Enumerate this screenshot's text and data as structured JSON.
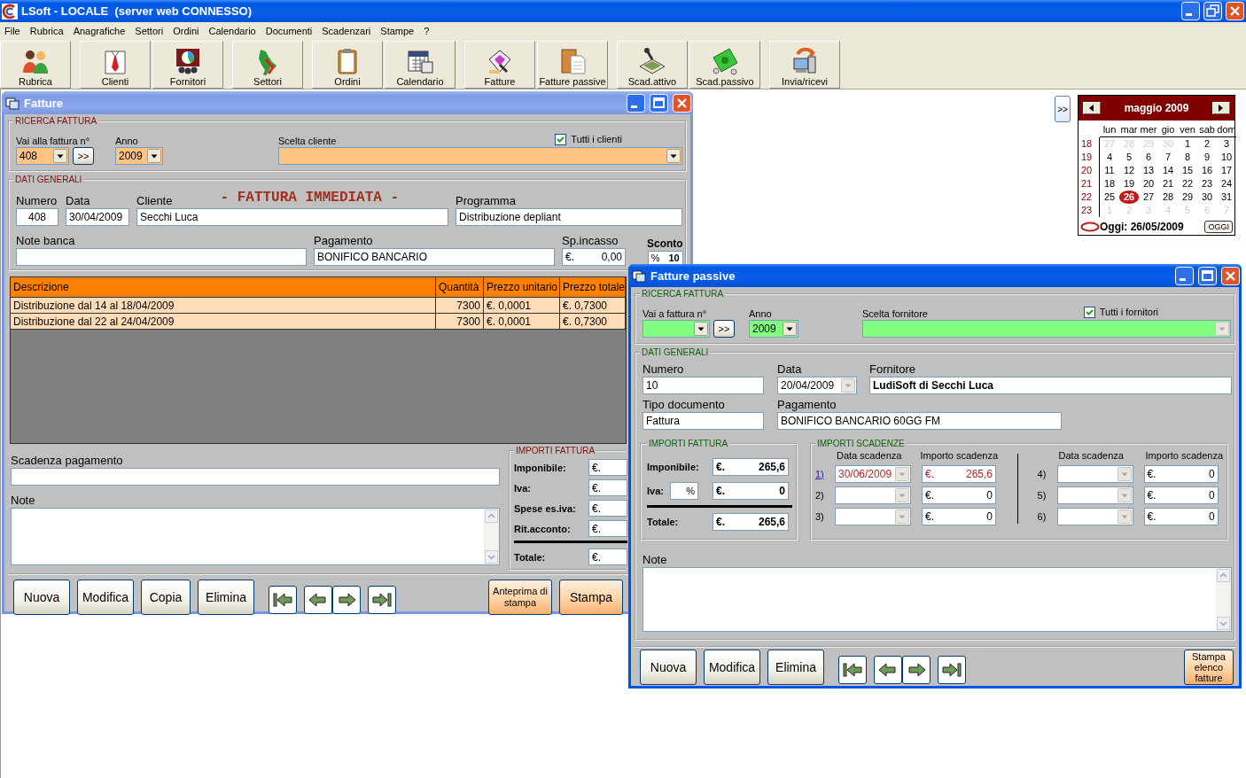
{
  "app": {
    "title": "LSoft - LOCALE  (server web CONNESSO)"
  },
  "menu": [
    "File",
    "Rubrica",
    "Anagrafiche",
    "Settori",
    "Ordini",
    "Calendario",
    "Documenti",
    "Scadenzari",
    "Stampe",
    "?"
  ],
  "toolbar": [
    "Rubrica",
    "Clienti",
    "Fornitori",
    "Settori",
    "Ordini",
    "Calendario",
    "Fatture",
    "Fatture passive",
    "Scad.attivo",
    "Scad.passivo",
    "Invia/ricevi"
  ],
  "invoice_window": {
    "title": "Fatture",
    "active": false,
    "search": {
      "legend": "RICERCA FATTURA",
      "goto_label": "Vai alla fattura n°",
      "goto_value": "408",
      "go_button": ">>",
      "year_label": "Anno",
      "year_value": "2009",
      "client_label": "Scelta cliente",
      "all_label": "Tutti i clienti",
      "all_checked": true
    },
    "general": {
      "legend": "DATI GENERALI",
      "doc_type": "- FATTURA IMMEDIATA -",
      "numero": {
        "label": "Numero",
        "value": "408"
      },
      "data": {
        "label": "Data",
        "value": "30/04/2009"
      },
      "cliente": {
        "label": "Cliente",
        "value": "Secchi Luca"
      },
      "programma": {
        "label": "Programma",
        "value": "Distribuzione depliant"
      },
      "note_banca": {
        "label": "Note banca"
      },
      "pagamento": {
        "label": "Pagamento",
        "value": "BONIFICO BANCARIO"
      },
      "sp_incasso": {
        "label": "Sp.incasso",
        "currency": "€.",
        "value": "0,00"
      },
      "sconto": {
        "label": "Sconto",
        "unit": "%",
        "value": "10"
      }
    },
    "table": {
      "columns": [
        "Descrizione",
        "Quantità",
        "Prezzo unitario",
        "Prezzo totale"
      ],
      "rows": [
        [
          "Distribuzione dal 14 al 18/04/2009",
          "7300",
          "€. 0,0001",
          "€. 0,7300"
        ],
        [
          "Distribuzione dal 22 al 24/04/2009",
          "7300",
          "€. 0,0001",
          "€. 0,7300"
        ]
      ]
    },
    "scadenza_label": "Scadenza pagamento",
    "note_label": "Note",
    "totals": {
      "legend": "IMPORTI FATTURA",
      "rows": [
        {
          "label": "Imponibile:",
          "currency": "€."
        },
        {
          "label": "Iva:",
          "currency": "€."
        },
        {
          "label": "Spese es.iva:",
          "currency": "€."
        },
        {
          "label": "Rit.acconto:",
          "currency": "€."
        },
        {
          "label": "Totale:",
          "currency": "€."
        }
      ]
    },
    "buttons": [
      "Nuova",
      "Modifica",
      "Copia",
      "Elimina"
    ],
    "print_buttons": [
      "Anteprima di stampa",
      "Stampa"
    ]
  },
  "calendar": {
    "toggle_button": ">>",
    "month": "maggio 2009",
    "weekdays": [
      "lun",
      "mar",
      "mer",
      "gio",
      "ven",
      "sab",
      "dom"
    ],
    "weeks": [
      {
        "number": "18",
        "days": [
          {
            "day": "27",
            "other_month": true,
            "today": false
          },
          {
            "day": "28",
            "other_month": true,
            "today": false
          },
          {
            "day": "29",
            "other_month": true,
            "today": false
          },
          {
            "day": "30",
            "other_month": true,
            "today": false
          },
          {
            "day": "1",
            "other_month": false,
            "today": false
          },
          {
            "day": "2",
            "other_month": false,
            "today": false
          },
          {
            "day": "3",
            "other_month": false,
            "today": false
          }
        ]
      },
      {
        "number": "19",
        "days": [
          {
            "day": "4",
            "other_month": false,
            "today": false
          },
          {
            "day": "5",
            "other_month": false,
            "today": false
          },
          {
            "day": "6",
            "other_month": false,
            "today": false
          },
          {
            "day": "7",
            "other_month": false,
            "today": false
          },
          {
            "day": "8",
            "other_month": false,
            "today": false
          },
          {
            "day": "9",
            "other_month": false,
            "today": false
          },
          {
            "day": "10",
            "other_month": false,
            "today": false
          }
        ]
      },
      {
        "number": "20",
        "days": [
          {
            "day": "11",
            "other_month": false,
            "today": false
          },
          {
            "day": "12",
            "other_month": false,
            "today": false
          },
          {
            "day": "13",
            "other_month": false,
            "today": false
          },
          {
            "day": "14",
            "other_month": false,
            "today": false
          },
          {
            "day": "15",
            "other_month": false,
            "today": false
          },
          {
            "day": "16",
            "other_month": false,
            "today": false
          },
          {
            "day": "17",
            "other_month": false,
            "today": false
          }
        ]
      },
      {
        "number": "21",
        "days": [
          {
            "day": "18",
            "other_month": false,
            "today": false
          },
          {
            "day": "19",
            "other_month": false,
            "today": false
          },
          {
            "day": "20",
            "other_month": false,
            "today": false
          },
          {
            "day": "21",
            "other_month": false,
            "today": false
          },
          {
            "day": "22",
            "other_month": false,
            "today": false
          },
          {
            "day": "23",
            "other_month": false,
            "today": false
          },
          {
            "day": "24",
            "other_month": false,
            "today": false
          }
        ]
      },
      {
        "number": "22",
        "days": [
          {
            "day": "25",
            "other_month": false,
            "today": false
          },
          {
            "day": "26",
            "other_month": false,
            "today": true
          },
          {
            "day": "27",
            "other_month": false,
            "today": false
          },
          {
            "day": "28",
            "other_month": false,
            "today": false
          },
          {
            "day": "29",
            "other_month": false,
            "today": false
          },
          {
            "day": "30",
            "other_month": false,
            "today": false
          },
          {
            "day": "31",
            "other_month": false,
            "today": false
          }
        ]
      },
      {
        "number": "23",
        "days": [
          {
            "day": "1",
            "other_month": true,
            "today": false
          },
          {
            "day": "2",
            "other_month": true,
            "today": false
          },
          {
            "day": "3",
            "other_month": true,
            "today": false
          },
          {
            "day": "4",
            "other_month": true,
            "today": false
          },
          {
            "day": "5",
            "other_month": true,
            "today": false
          },
          {
            "day": "6",
            "other_month": true,
            "today": false
          },
          {
            "day": "7",
            "other_month": true,
            "today": false
          }
        ]
      }
    ],
    "today_text": "Oggi: 26/05/2009",
    "today_button": "OGGI"
  },
  "passive_window": {
    "title": "Fatture passive",
    "active": true,
    "search": {
      "legend": "RICERCA FATTURA",
      "goto_label": "Vai a fattura n°",
      "go_button": ">>",
      "year_label": "Anno",
      "year_value": "2009",
      "supplier_label": "Scelta fornitore",
      "all_label": "Tutti i fornitori",
      "all_checked": true
    },
    "general": {
      "legend": "DATI GENERALI",
      "numero": {
        "label": "Numero",
        "value": "10"
      },
      "data": {
        "label": "Data",
        "value": "20/04/2009"
      },
      "fornitore": {
        "label": "Fornitore",
        "value": "LudiSoft di Secchi Luca"
      },
      "tipo": {
        "label": "Tipo documento",
        "value": "Fattura"
      },
      "pagamento": {
        "label": "Pagamento",
        "value": "BONIFICO BANCARIO 60GG FM"
      }
    },
    "totals": {
      "legend": "IMPORTI FATTURA",
      "imponibile": {
        "label": "Imponibile:",
        "currency": "€.",
        "value": "265,6"
      },
      "iva": {
        "label": "Iva:",
        "unit": "%",
        "currency": "€.",
        "value": "0"
      },
      "totale": {
        "label": "Totale:",
        "currency": "€.",
        "value": "265,6"
      }
    },
    "due": {
      "legend": "IMPORTI SCADENZE",
      "headers": [
        "Data scadenza",
        "Importo scadenza",
        "Data scadenza",
        "Importo scadenza"
      ],
      "rows": [
        {
          "index": "1)",
          "date": "30/06/2009",
          "currency": "€.",
          "amount": "265,6",
          "highlighted": true
        },
        {
          "index": "2)",
          "currency": "€.",
          "amount": "0",
          "highlighted": false
        },
        {
          "index": "3)",
          "currency": "€.",
          "amount": "0",
          "highlighted": false
        },
        {
          "index": "4)",
          "currency": "€.",
          "amount": "0",
          "highlighted": false
        },
        {
          "index": "5)",
          "currency": "€.",
          "amount": "0",
          "highlighted": false
        },
        {
          "index": "6)",
          "currency": "€.",
          "amount": "0",
          "highlighted": false
        }
      ]
    },
    "note_label": "Note",
    "buttons": [
      "Nuova",
      "Modifica",
      "Elimina"
    ],
    "print_button": "Stampa elenco fatture"
  }
}
